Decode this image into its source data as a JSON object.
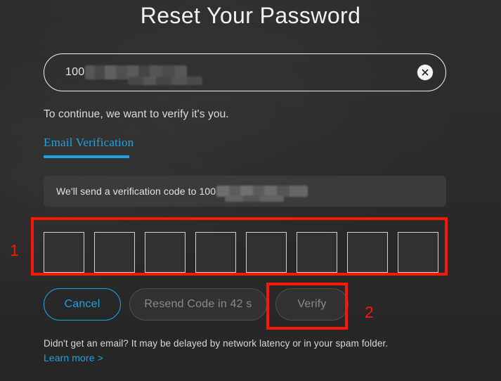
{
  "page": {
    "title": "Reset Your Password",
    "subtitle": "To continue, we want to verify it's you."
  },
  "email_field": {
    "value_prefix": "100",
    "redacted": true,
    "clear_icon": "close-circle-icon"
  },
  "tabs": [
    {
      "label": "Email Verification",
      "active": true
    }
  ],
  "info_banner": {
    "text": "We'll send a verification code to 100",
    "redacted": true
  },
  "code_input": {
    "length": 8,
    "values": [
      "",
      "",
      "",
      "",
      "",
      "",
      "",
      ""
    ]
  },
  "buttons": {
    "cancel": "Cancel",
    "resend": "Resend Code in 42 s",
    "verify": "Verify"
  },
  "footer": {
    "text": "Didn't get an email? It may be delayed by network latency or in your spam folder.",
    "link": "Learn more >"
  },
  "annotations": [
    {
      "number": "1",
      "target": "code-input-row"
    },
    {
      "number": "2",
      "target": "verify-button"
    }
  ],
  "colors": {
    "accent": "#1fa2e0",
    "annotation": "#f81807",
    "background": "#2b2b2b",
    "banner": "#3b3b3b",
    "text": "#e8e8e8",
    "disabled_text": "#8a8a8a"
  }
}
